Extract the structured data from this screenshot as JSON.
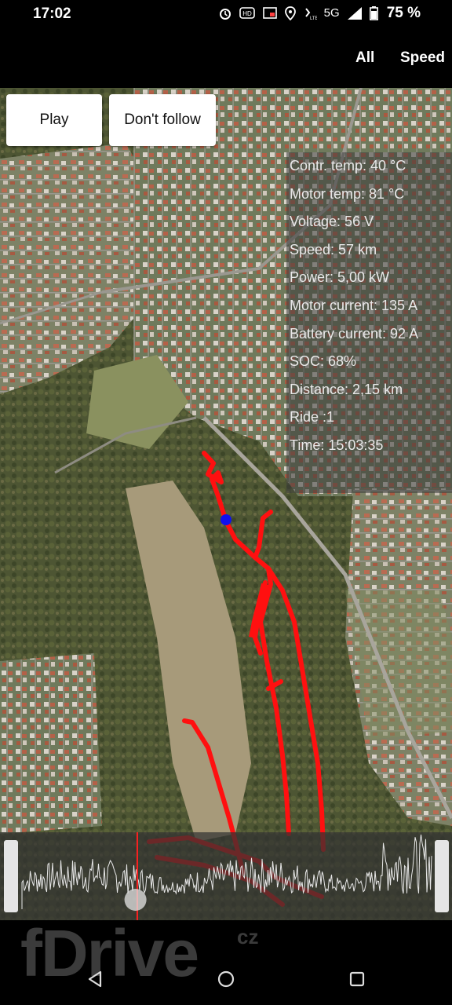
{
  "status_bar": {
    "time": "17:02",
    "network": "5G",
    "battery_percent": "75 %",
    "icons": [
      "alarm-icon",
      "hd-voice-icon",
      "cast-icon",
      "location-icon",
      "volte-icon",
      "signal-icon",
      "battery-icon"
    ]
  },
  "app_bar": {
    "menu_all": "All",
    "menu_speed": "Speed"
  },
  "map_controls": {
    "play": "Play",
    "follow": "Don't follow"
  },
  "telemetry": {
    "controller_temp": "Contr. temp: 40 °C",
    "motor_temp": "Motor temp: 81 °C",
    "voltage": "Voltage: 56 V",
    "speed": "Speed: 57 km",
    "power": "Power: 5,00 kW",
    "motor_current": "Motor current: 135 A",
    "battery_current": "Battery current: 92 A",
    "soc": "SOC: 68%",
    "distance": "Distance: 2,15 km",
    "ride": "Ride :1",
    "time": "Time: 15:03:35"
  },
  "timeline": {
    "playhead_position": 0.27,
    "cursor_position": 0.3
  },
  "watermark": {
    "brand": "fDrive",
    "tld": "cz"
  },
  "colors": {
    "track": "#ff1010",
    "position_marker": "#1010ee",
    "telemetry_text": "#e9e9e9"
  }
}
